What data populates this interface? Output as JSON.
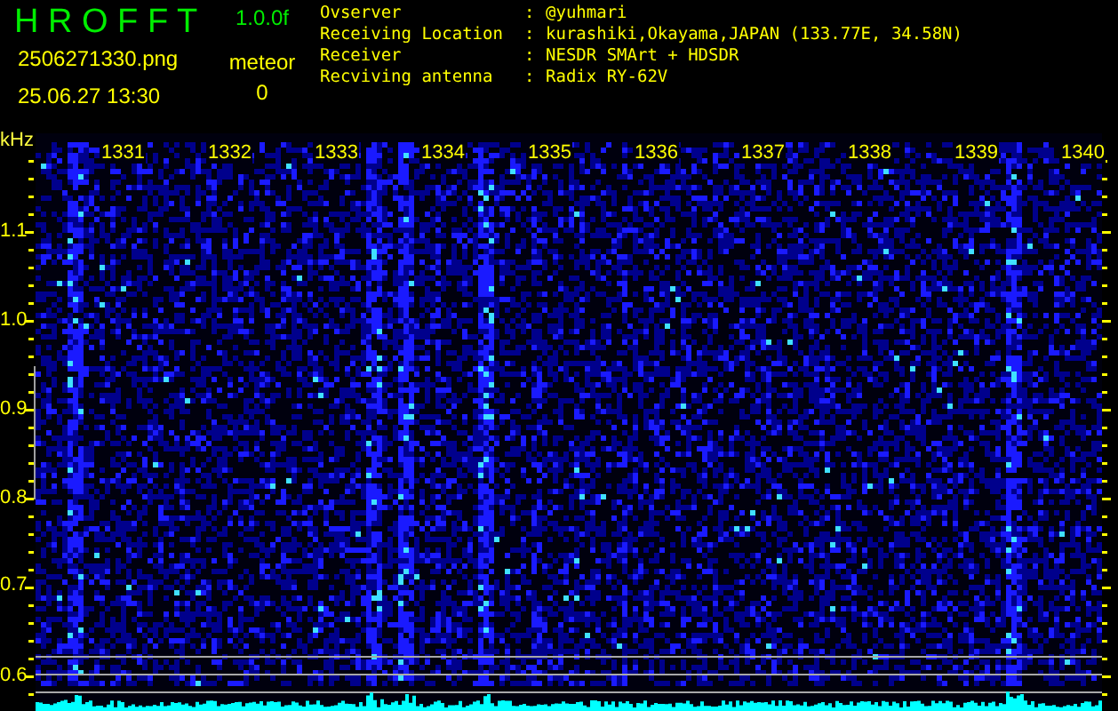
{
  "app": {
    "title": "H R O F F T",
    "version": "1.0.0f"
  },
  "file": {
    "name": "2506271330.png",
    "timestamp": "25.06.27 13:30"
  },
  "counter": {
    "label": "meteor",
    "value": "0"
  },
  "info": [
    {
      "label": "Ovserver",
      "separator": ":",
      "value": "@yuhmari"
    },
    {
      "label": "Receiving Location",
      "separator": ":",
      "value": "kurashiki,Okayama,JAPAN (133.77E, 34.58N)"
    },
    {
      "label": "Receiver",
      "separator": ":",
      "value": "NESDR SMArt + HDSDR"
    },
    {
      "label": "Recviving antenna",
      "separator": ":",
      "value": "Radix RY-62V"
    }
  ],
  "spectrogram": {
    "unit": "kHz",
    "x_labels": [
      "1331",
      "1332",
      "1333",
      "1334",
      "1335",
      "1336",
      "1337",
      "1338",
      "1339",
      "1340"
    ],
    "y_labels": [
      "1.1",
      "1.0",
      "0.9",
      "0.8",
      "0.7",
      "0.6"
    ]
  }
}
